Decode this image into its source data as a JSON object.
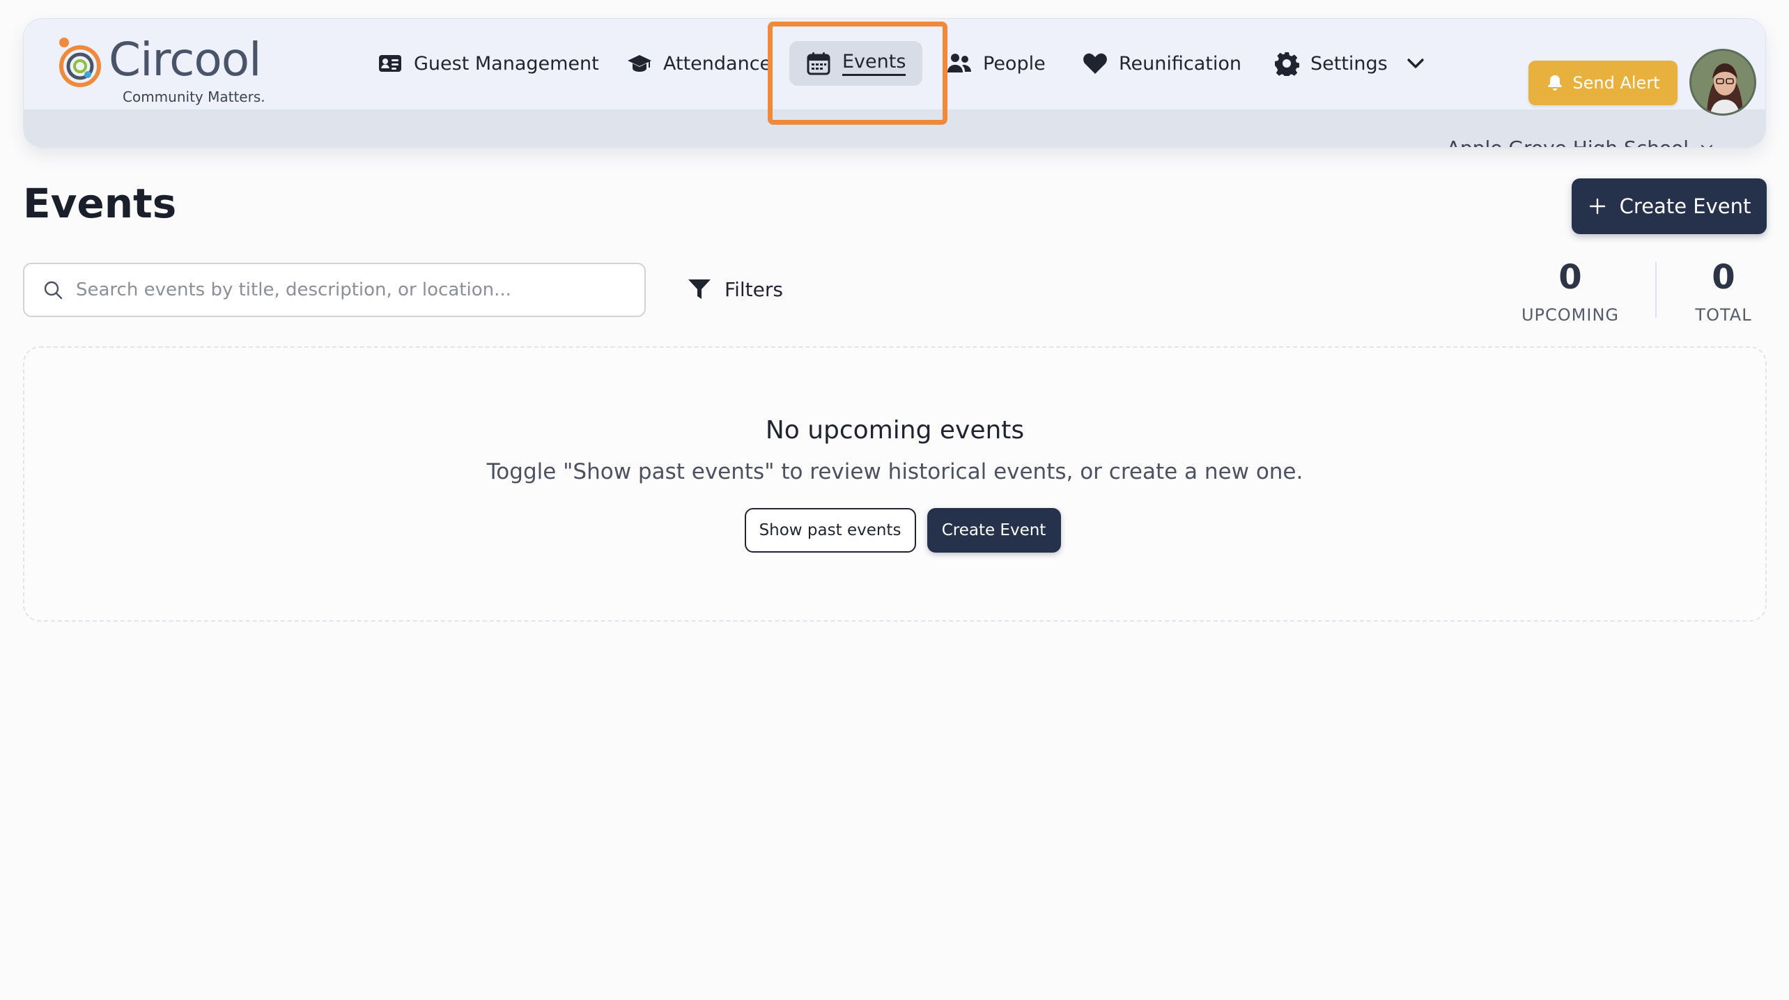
{
  "app": {
    "name": "Circool",
    "tagline": "Community Matters."
  },
  "nav": {
    "guest_management": "Guest Management",
    "attendance": "Attendance",
    "events": "Events",
    "people": "People",
    "reunification": "Reunification",
    "settings": "Settings",
    "active": "events"
  },
  "header": {
    "send_alert": "Send Alert",
    "school": "Apple Grove High School"
  },
  "main": {
    "title": "Events",
    "create_event": "Create Event",
    "search_placeholder": "Search events by title, description, or location...",
    "search_value": "",
    "filters": "Filters",
    "stats": [
      {
        "value": "0",
        "label": "UPCOMING"
      },
      {
        "value": "0",
        "label": "TOTAL"
      }
    ]
  },
  "empty": {
    "title": "No upcoming events",
    "subtitle": "Toggle \"Show past events\" to review historical events, or create a new one.",
    "show_past": "Show past events",
    "create": "Create Event"
  },
  "colors": {
    "primary_dark": "#26324c",
    "alert": "#e8b03c",
    "highlight": "#f0893a"
  },
  "icons": {
    "guest_management": "id-card-icon",
    "attendance": "graduation-cap-icon",
    "events": "calendar-icon",
    "people": "users-icon",
    "reunification": "heart-icon",
    "settings": "gear-icon",
    "send_alert": "bell-icon",
    "search": "search-icon",
    "filters": "funnel-icon",
    "create": "plus-icon"
  }
}
